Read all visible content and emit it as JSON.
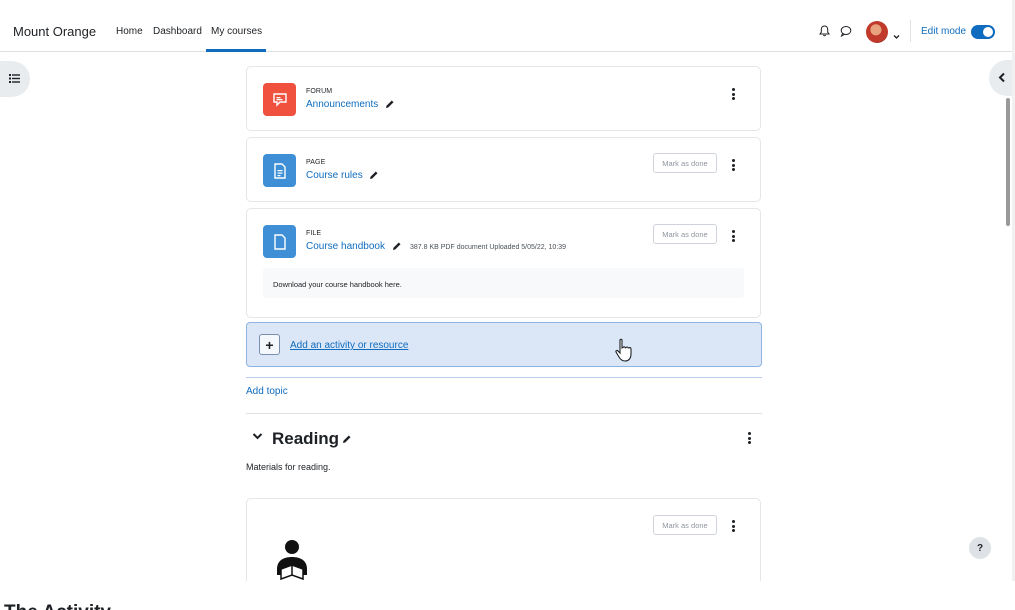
{
  "navbar": {
    "brand": "Mount Orange",
    "links": [
      "Home",
      "Dashboard",
      "My courses"
    ],
    "active_link": "My courses",
    "edit_mode_label": "Edit mode",
    "edit_mode_on": true,
    "accent_color": "#0f6cbf"
  },
  "activities": [
    {
      "type": "FORUM",
      "name": "Announcements",
      "icon": "forum-icon",
      "icon_color": "#f0513e",
      "show_mark_done": false
    },
    {
      "type": "PAGE",
      "name": "Course rules",
      "icon": "page-icon",
      "icon_color": "#3e8fd6",
      "show_mark_done": true,
      "mark_done_label": "Mark as done"
    },
    {
      "type": "FILE",
      "name": "Course handbook",
      "icon": "file-icon",
      "icon_color": "#3e8fd6",
      "meta": "387.8 KB PDF document Uploaded 5/05/22, 10:39",
      "description": "Download your course handbook here.",
      "show_mark_done": true,
      "mark_done_label": "Mark as done"
    }
  ],
  "add_activity_label": "Add an activity or resource",
  "add_topic_label": "Add topic",
  "section": {
    "title": "Reading",
    "summary": "Materials for reading.",
    "card": {
      "mark_done_label": "Mark as done",
      "icon": "reading-person-icon"
    }
  },
  "help_label": "?",
  "bottom_text": "The Activity..."
}
